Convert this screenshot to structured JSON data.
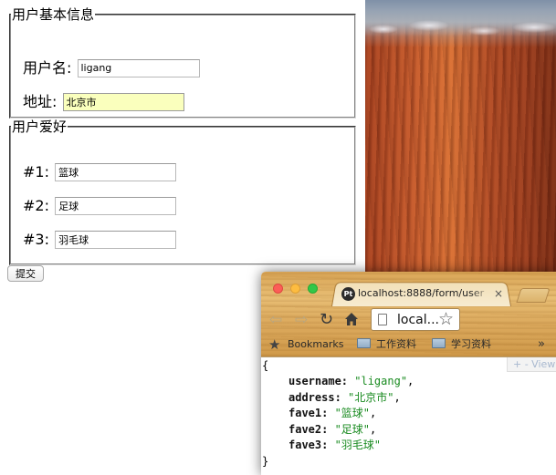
{
  "form": {
    "basic_legend": "用户基本信息",
    "username_label": "用户名:",
    "username_value": "ligang",
    "address_label": "地址:",
    "address_value": "北京市",
    "favorites_legend": "用户爱好",
    "faves": [
      {
        "label": "#1:",
        "value": "篮球"
      },
      {
        "label": "#2:",
        "value": "足球"
      },
      {
        "label": "#3:",
        "value": "羽毛球"
      }
    ],
    "submit_label": "提交"
  },
  "browser": {
    "favicon_text": "Pt",
    "tab_title": "localhost:8888/form/user",
    "tab_close": "×",
    "omnibox_text": "local...",
    "bookmarks_bar": {
      "bookmarks_label": "Bookmarks",
      "folder1": "工作资料",
      "folder2": "学习资料",
      "more": "»"
    },
    "viewer_toggle": "+  -  View"
  },
  "response": {
    "open_brace": "{",
    "close_brace": "}",
    "lines": [
      {
        "key": "username",
        "value": "\"ligang\"",
        "sep": ","
      },
      {
        "key": "address",
        "value": "\"北京市\"",
        "sep": ","
      },
      {
        "key": "fave1",
        "value": "\"篮球\"",
        "sep": ","
      },
      {
        "key": "fave2",
        "value": "\"足球\"",
        "sep": ","
      },
      {
        "key": "fave3",
        "value": "\"羽毛球\"",
        "sep": ""
      }
    ]
  },
  "colors": {
    "autofill_yellow": "#faffbd",
    "json_string_green": "#188a1f",
    "close_red": "#fc5d57",
    "minimize_yellow": "#fdbc40",
    "maximize_green": "#33c748"
  },
  "icons": {
    "nav_back": "arrow-left-icon",
    "nav_forward": "arrow-right-icon",
    "reload": "reload-icon",
    "home": "home-icon",
    "page": "page-icon",
    "star": "star-icon",
    "bookmark_star": "star-icon",
    "folder": "folder-icon"
  }
}
